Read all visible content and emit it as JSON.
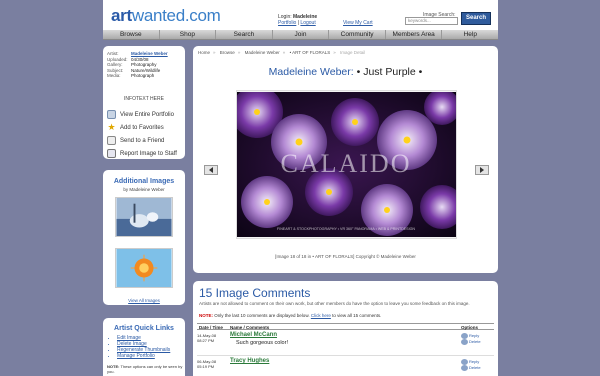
{
  "header": {
    "logo_part1": "art",
    "logo_part2": "wanted.com",
    "login_label": "Login:",
    "login_user": "Madeleine",
    "portfolio_link": "Portfolio",
    "logout_link": "Logout",
    "cart_link": "View My Cart",
    "search_label": "Image Search:",
    "search_placeholder": "keywords...",
    "search_button": "Search"
  },
  "nav": [
    "Browse",
    "Shop",
    "Search",
    "Join",
    "Community",
    "Members Area",
    "Help"
  ],
  "info": {
    "rows": [
      {
        "k": "Artist:",
        "v": "Madeleine Weber"
      },
      {
        "k": "Uploaded:",
        "v": "04/30/08"
      },
      {
        "k": "Gallery:",
        "v": "Photography"
      },
      {
        "k": "Subject:",
        "v": "Nature/Wildlife"
      },
      {
        "k": "Media:",
        "v": "Photograph"
      }
    ],
    "infotext": "INFOTEXT HERE",
    "actions": [
      "View Entire Portfolio",
      "Add to Favorites",
      "Send to a Friend",
      "Report Image to Staff"
    ]
  },
  "additional": {
    "title": "Additional Images",
    "by": "by Madeleine Weber",
    "view_all": "View All Images"
  },
  "quick_links": {
    "title": "Artist Quick Links",
    "items": [
      "Edit Image",
      "Delete Image",
      "Regenerate Thumbnails",
      "Manage Portfolio"
    ],
    "note_label": "NOTE:",
    "note": "These options can only be seen by you."
  },
  "main": {
    "breadcrumb": [
      "Home",
      "Browse",
      "Madeleine Weber",
      "• ART OF FLORALS",
      "Image Detail"
    ],
    "artist": "Madeleine Weber:",
    "work_title": "• Just Purple •",
    "watermark": "CALAIDO",
    "watermark_small": "FINEART & STOCKPHOTOGRAPHY • VR 360° PANORAMA • WEB & PRINTDESIGN",
    "caption": "[Image 18 of 18 in • ART OF FLORALS]  Copyright © Madeleine Weber"
  },
  "comments": {
    "title": "15 Image Comments",
    "desc": "Artists are not allowed to comment on their own work, but other members do have the option to leave you some feedback on this image.",
    "note_label": "NOTE:",
    "note_text": "Only the last 10 comments are displayed below.",
    "note_link": "Click here",
    "note_tail": "to view all 15 comments.",
    "headers": {
      "date": "Date / Time",
      "name": "Name / Comments",
      "options": "Options"
    },
    "rows": [
      {
        "date": "14-May-08",
        "time": "08:27 PM",
        "name": "Michael McCann",
        "text": "Such gorgeous color!",
        "opt1": "Reply",
        "opt2": "Delete"
      },
      {
        "date": "06-May-08",
        "time": "05:19 PM",
        "name": "Tracy Hughes",
        "text": "",
        "opt1": "Reply",
        "opt2": "Delete"
      }
    ]
  },
  "colors": {
    "background": "#7a7fa0",
    "link": "#2b5aa5",
    "search_button": "#2f5b9c"
  }
}
